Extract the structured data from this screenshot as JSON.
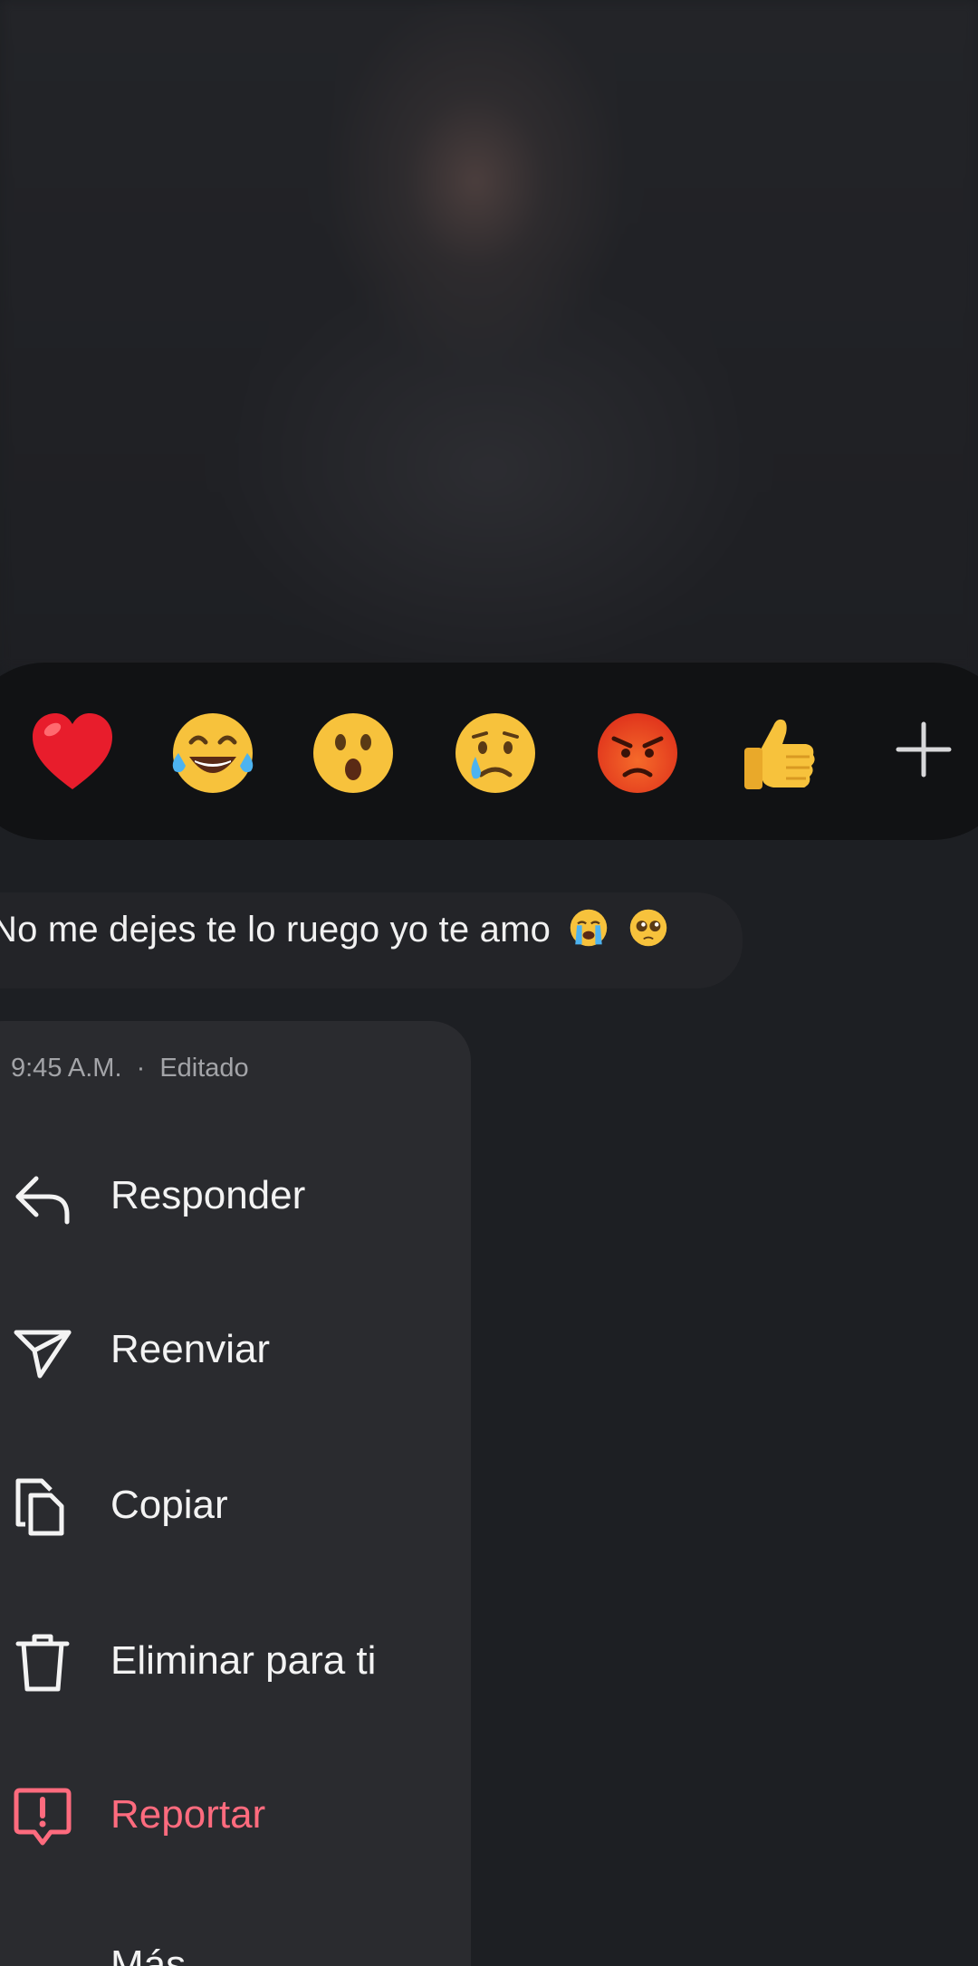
{
  "reactions": [
    {
      "name": "heart",
      "icon": "red-heart-emoji"
    },
    {
      "name": "laughing",
      "icon": "tears-of-joy-emoji"
    },
    {
      "name": "surprised",
      "icon": "surprised-face-emoji"
    },
    {
      "name": "sad",
      "icon": "crying-face-emoji"
    },
    {
      "name": "angry",
      "icon": "angry-face-emoji"
    },
    {
      "name": "thumbs-up",
      "icon": "thumbs-up-emoji"
    }
  ],
  "add_reaction_icon": "plus-icon",
  "message": {
    "text": "No me dejes te lo ruego yo te amo",
    "emojis": [
      "loudly-crying-emoji",
      "pleading-face-emoji"
    ]
  },
  "menu": {
    "time": "9:45 A.M.",
    "separator": "·",
    "status": "Editado",
    "items": [
      {
        "label": "Responder",
        "icon": "reply-icon"
      },
      {
        "label": "Reenviar",
        "icon": "send-icon"
      },
      {
        "label": "Copiar",
        "icon": "copy-icon"
      },
      {
        "label": "Eliminar para ti",
        "icon": "trash-icon"
      },
      {
        "label": "Reportar",
        "icon": "report-icon",
        "color": "#ff6b7e"
      }
    ],
    "more_label": "Más"
  },
  "colors": {
    "background": "#1d1f23",
    "reaction_bar": "#111214",
    "menu": "#2a2b2f",
    "danger": "#ff6b7e"
  }
}
